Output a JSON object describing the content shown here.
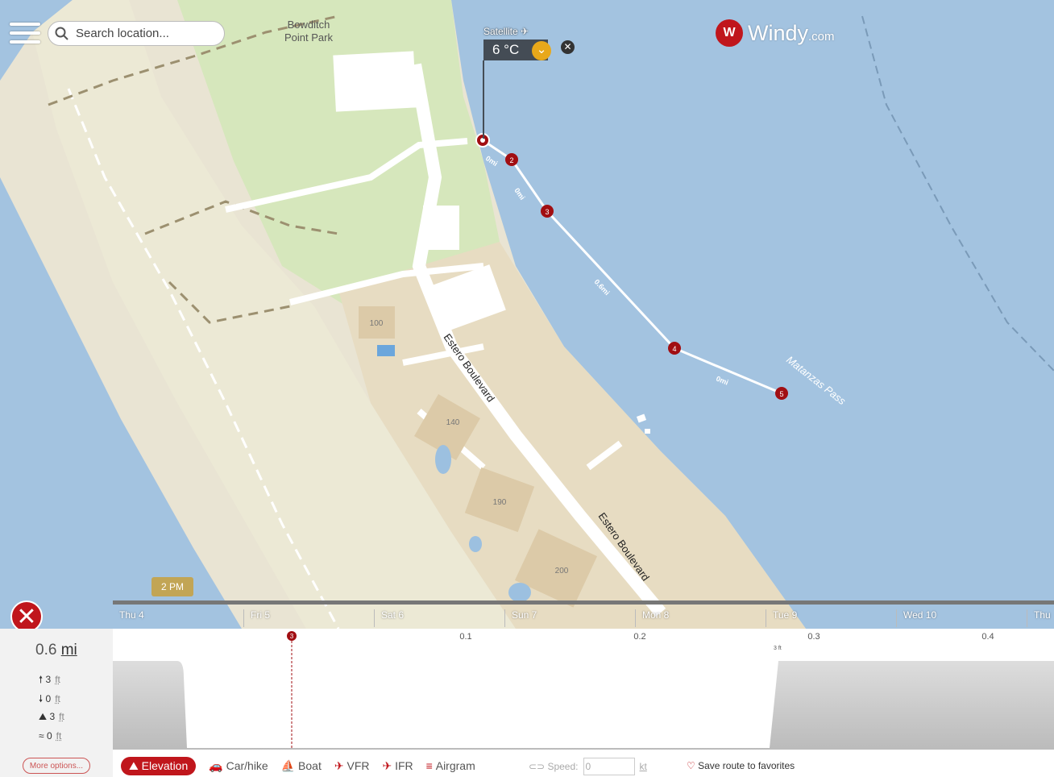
{
  "search": {
    "placeholder": "Search location..."
  },
  "logo": {
    "brand": "Windy",
    "domain": ".com"
  },
  "layer": {
    "label": "Satellite",
    "temperature": "6 °C"
  },
  "map_labels": {
    "park": [
      "Bowditch",
      "Point Park"
    ],
    "street1": "Estero Boulevard",
    "street2": "Estero Boulevard",
    "water": "Matanzas Pass",
    "buildings": [
      "100",
      "140",
      "190",
      "200"
    ]
  },
  "route": {
    "waypoints": [
      "1",
      "2",
      "3",
      "4",
      "5"
    ],
    "segments": [
      "0mi",
      "0mi",
      "0.6mi",
      "0mi"
    ]
  },
  "timeline": {
    "current_time": "2 PM",
    "days": [
      "Thu 4",
      "Fri 5",
      "Sat 6",
      "Sun 7",
      "Mon 8",
      "Tue 9",
      "Wed 10",
      "Thu"
    ]
  },
  "stats": {
    "distance": "0.6",
    "distance_unit": "mi",
    "ascent": "3",
    "descent": "0",
    "max_elevation": "3",
    "min_elevation": "0",
    "unit": "ft",
    "more_options": "More options..."
  },
  "profile": {
    "x_ticks": [
      "0.1",
      "0.2",
      "0.3",
      "0.4"
    ],
    "marker": "3",
    "label_3ft": "3 ft"
  },
  "modes": {
    "elevation": "Elevation",
    "car": "Car/hike",
    "boat": "Boat",
    "vfr": "VFR",
    "ifr": "IFR",
    "airgram": "Airgram"
  },
  "speed": {
    "label": "Speed:",
    "value": "0",
    "unit": "kt"
  },
  "favorites": "Save route to favorites"
}
